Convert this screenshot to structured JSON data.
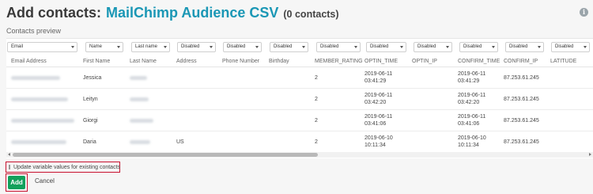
{
  "header": {
    "title_prefix": "Add contacts:",
    "source_name": "MailChimp Audience CSV",
    "count": "(0 contacts)",
    "info_icon": "info-icon"
  },
  "preview": {
    "label": "Contacts preview",
    "mappings": [
      "Email",
      "Name",
      "Last name",
      "Disabled",
      "Disabled",
      "Disabled",
      "Disabled",
      "Disabled",
      "Disabled",
      "Disabled",
      "Disabled",
      "Disabled"
    ],
    "columns": [
      "Email Address",
      "First Name",
      "Last Name",
      "Address",
      "Phone Number",
      "Birthday",
      "MEMBER_RATING",
      "OPTIN_TIME",
      "OPTIN_IP",
      "CONFIRM_TIME",
      "CONFIRM_IP",
      "LATITUDE"
    ],
    "rows": [
      {
        "first_name": "Jessica",
        "address": "",
        "rating": "2",
        "optin_date": "2019-06-11",
        "optin_clock": "03:41:29",
        "confirm_date": "2019-06-11",
        "confirm_clock": "03:41:29",
        "confirm_ip": "87.253.61.245"
      },
      {
        "first_name": "Leityn",
        "address": "",
        "rating": "2",
        "optin_date": "2019-06-11",
        "optin_clock": "03:42:20",
        "confirm_date": "2019-06-11",
        "confirm_clock": "03:42:20",
        "confirm_ip": "87.253.61.245"
      },
      {
        "first_name": "Giorgi",
        "address": "",
        "rating": "2",
        "optin_date": "2019-06-11",
        "optin_clock": "03:41:06",
        "confirm_date": "2019-06-11",
        "confirm_clock": "03:41:06",
        "confirm_ip": "87.253.61.245"
      },
      {
        "first_name": "Daria",
        "address": "US",
        "rating": "2",
        "optin_date": "2019-06-10",
        "optin_clock": "10:11:34",
        "confirm_date": "2019-06-10",
        "confirm_clock": "10:11:34",
        "confirm_ip": "87.253.61.245"
      }
    ]
  },
  "options": {
    "update_label": "Update variable values for existing contacts",
    "update_checked": false
  },
  "actions": {
    "add_label": "Add",
    "cancel_label": "Cancel"
  },
  "colors": {
    "accent": "#1a97b5",
    "primary_button": "#12a05b",
    "highlight": "#c8102e"
  }
}
